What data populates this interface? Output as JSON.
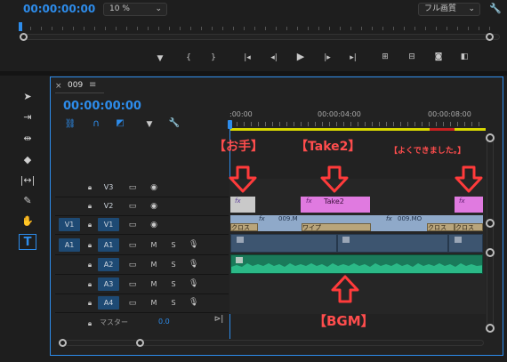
{
  "source": {
    "timecode": "00:00:00:00",
    "zoom": "10 %",
    "quality": "フル画質"
  },
  "seq": {
    "close": "×",
    "name": "009",
    "menu": "≡",
    "timecode": "00:00:00:00",
    "ruler": [
      ":00:00",
      "00:00:04:00",
      "00:00:08:00"
    ]
  },
  "tracks": [
    {
      "id": "V3",
      "src": "",
      "type": "v"
    },
    {
      "id": "V2",
      "src": "",
      "type": "v"
    },
    {
      "id": "V1",
      "src": "V1",
      "type": "v"
    },
    {
      "id": "A1",
      "src": "A1",
      "type": "a"
    },
    {
      "id": "A2",
      "src": "",
      "type": "a"
    },
    {
      "id": "A3",
      "src": "",
      "type": "a"
    },
    {
      "id": "A4",
      "src": "",
      "type": "a"
    }
  ],
  "track_btn": {
    "m": "M",
    "s": "S"
  },
  "master": {
    "label": "マスター",
    "value": "0.0"
  },
  "clips": {
    "fx": "fx",
    "take2": "Take2",
    "v1a": "009.M",
    "v1b": "009.MO",
    "cross1": "クロス",
    "wipe": "ワイプ",
    "cross2": "クロス",
    "cross3": "クロス"
  },
  "annotations": {
    "ote": "【お手】",
    "take2": "【Take2】",
    "yoku": "【よくできました。】",
    "bgm": "【BGM】"
  },
  "colors": {
    "accent": "#2d8ceb",
    "pink": "#e07ae0",
    "audio": "#1f9e72",
    "annotation": "#ff4d4d"
  }
}
